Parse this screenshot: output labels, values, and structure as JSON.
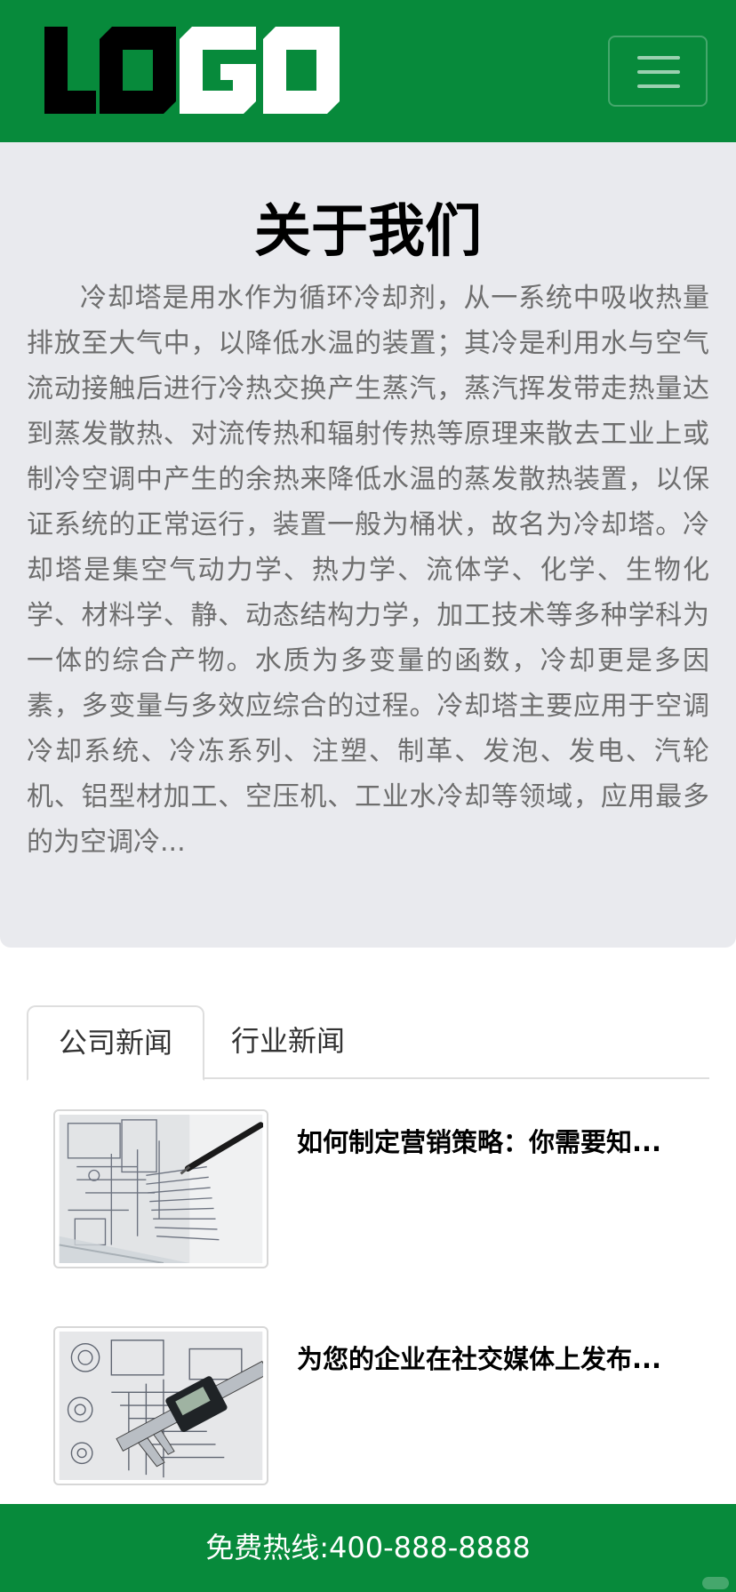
{
  "header": {
    "logo_text": "LOGO",
    "logo_icon": "logo",
    "menu_icon": "hamburger-menu-icon"
  },
  "about": {
    "title": "关于我们",
    "body": "冷却塔是用水作为循环冷却剂，从一系统中吸收热量排放至大气中，以降低水温的装置；其冷是利用水与空气流动接触后进行冷热交换产生蒸汽，蒸汽挥发带走热量达到蒸发散热、对流传热和辐射传热等原理来散去工业上或制冷空调中产生的余热来降低水温的蒸发散热装置，以保证系统的正常运行，装置一般为桶状，故名为冷却塔。冷却塔是集空气动力学、热力学、流体学、化学、生物化学、材料学、静、动态结构力学，加工技术等多种学科为一体的综合产物。水质为多变量的函数，冷却更是多因素，多变量与多效应综合的过程。冷却塔主要应用于空调冷却系统、冷冻系列、注塑、制革、发泡、发电、汽轮机、铝型材加工、空压机、工业水冷却等领域，应用最多的为空调冷..."
  },
  "tabs": [
    {
      "label": "公司新闻",
      "active": true
    },
    {
      "label": "行业新闻",
      "active": false
    }
  ],
  "news": [
    {
      "title": "如何制定营销策略：你需要知...",
      "image": "blueprint-with-pen"
    },
    {
      "title": "为您的企业在社交媒体上发布...",
      "image": "blueprint-with-caliper"
    }
  ],
  "footer": {
    "hotline": "免费热线:400-888-8888"
  },
  "colors": {
    "brand_green": "#078a3b",
    "about_bg": "#e9eaee",
    "body_text": "#6e6e6e"
  }
}
